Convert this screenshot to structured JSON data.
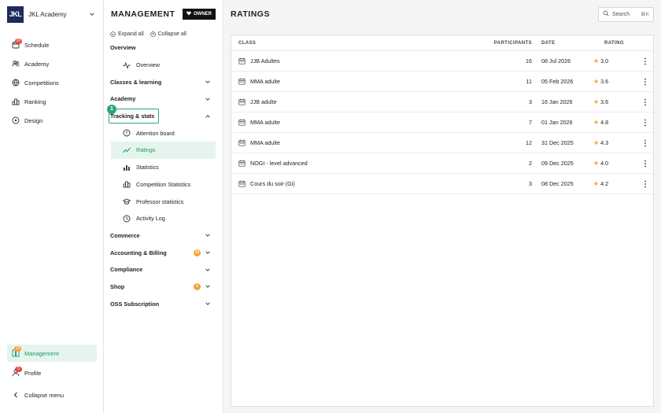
{
  "brand": {
    "name": "JKL Academy",
    "logo_text": "JKL"
  },
  "left_nav": {
    "items": [
      {
        "label": "Schedule",
        "icon": "calendar-icon",
        "badge": "20"
      },
      {
        "label": "Academy",
        "icon": "users-icon",
        "badge": ""
      },
      {
        "label": "Competitions",
        "icon": "globe-icon",
        "badge": ""
      },
      {
        "label": "Ranking",
        "icon": "ranking-icon",
        "badge": ""
      },
      {
        "label": "Design",
        "icon": "palette-icon",
        "badge": ""
      }
    ],
    "bottom": [
      {
        "label": "Management",
        "icon": "management-icon",
        "badge": "13"
      },
      {
        "label": "Profile",
        "icon": "user-icon",
        "badge": "5"
      }
    ],
    "collapse_label": "Collapse menu"
  },
  "management": {
    "title": "MANAGEMENT",
    "owner_label": "OWNER",
    "expand_all": "Expand all",
    "collapse_all": "Collapse all",
    "overview_section": "Overview",
    "overview_item": "Overview",
    "sections": {
      "classes": "Classes & learning",
      "academy": "Academy",
      "tracking": "Tracking & stats",
      "commerce": "Commerce",
      "accounting": "Accounting & Billing",
      "accounting_badge": "10",
      "compliance": "Compliance",
      "shop": "Shop",
      "shop_badge": "3",
      "oss": "OSS Subscription"
    },
    "tracking_items": [
      "Attention board",
      "Ratings",
      "Statistics",
      "Competition Statistics",
      "Professor statistics",
      "Activity Log"
    ],
    "highlight_number": "1"
  },
  "main": {
    "title": "RATINGS",
    "search_label": "Search",
    "search_shortcut": "⌘K",
    "columns": {
      "class": "CLASS",
      "participants": "PARTICIPANTS",
      "date": "DATE",
      "rating": "RATING"
    },
    "rows": [
      {
        "class": "JJB Adultes",
        "participants": "16",
        "date": "08 Jul 2026",
        "rating": "3.0"
      },
      {
        "class": "MMA adulte",
        "participants": "11",
        "date": "05 Feb 2026",
        "rating": "3.6"
      },
      {
        "class": "JJB adulte",
        "participants": "3",
        "date": "16 Jan 2026",
        "rating": "3.6"
      },
      {
        "class": "MMA adulte",
        "participants": "7",
        "date": "01 Jan 2026",
        "rating": "4.8"
      },
      {
        "class": "MMA adulte",
        "participants": "12",
        "date": "31 Dec 2025",
        "rating": "4.3"
      },
      {
        "class": "NOGI - level advanced",
        "participants": "2",
        "date": "09 Dec 2025",
        "rating": "4.0"
      },
      {
        "class": "Cours du soir (Gi)",
        "participants": "3",
        "date": "08 Dec 2025",
        "rating": "4.2"
      }
    ]
  },
  "colors": {
    "accent": "#1a9a63",
    "highlight": "#2aa873",
    "badge_red": "#e0483e",
    "badge_orange": "#f0a431",
    "star": "#f0a431",
    "logo_bg": "#1d2a5c"
  }
}
